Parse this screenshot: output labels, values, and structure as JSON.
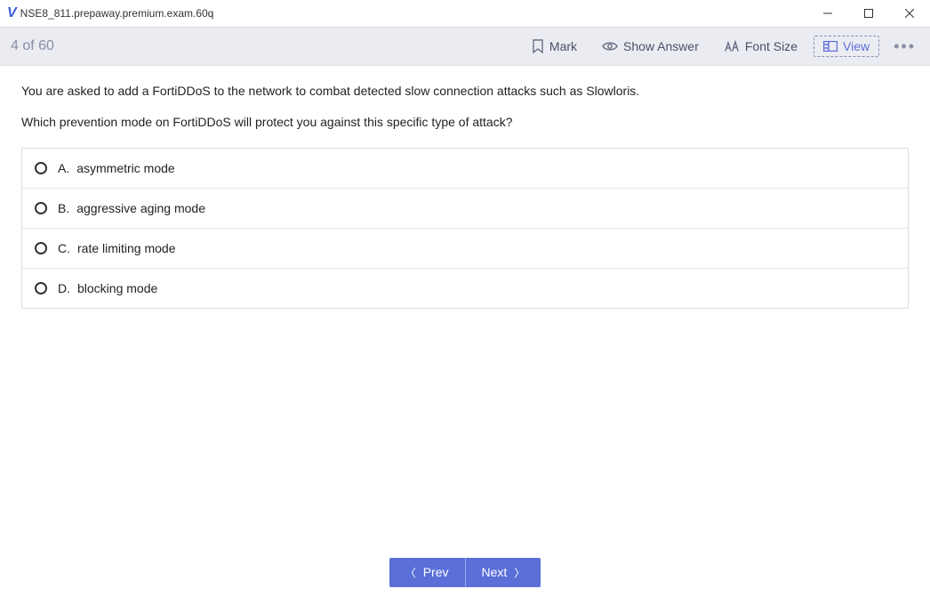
{
  "window": {
    "title": "NSE8_811.prepaway.premium.exam.60q"
  },
  "toolbar": {
    "progress": "4 of 60",
    "mark": "Mark",
    "show_answer": "Show Answer",
    "font_size": "Font Size",
    "view": "View"
  },
  "question": {
    "line1": "You are asked to add a FortiDDoS to the network to combat detected slow connection attacks such as Slowloris.",
    "line2": "Which prevention mode on FortiDDoS will protect you against this specific type of attack?"
  },
  "answers": [
    {
      "letter": "A.",
      "text": "asymmetric mode"
    },
    {
      "letter": "B.",
      "text": "aggressive aging mode"
    },
    {
      "letter": "C.",
      "text": "rate limiting mode"
    },
    {
      "letter": "D.",
      "text": "blocking mode"
    }
  ],
  "nav": {
    "prev": "Prev",
    "next": "Next"
  }
}
